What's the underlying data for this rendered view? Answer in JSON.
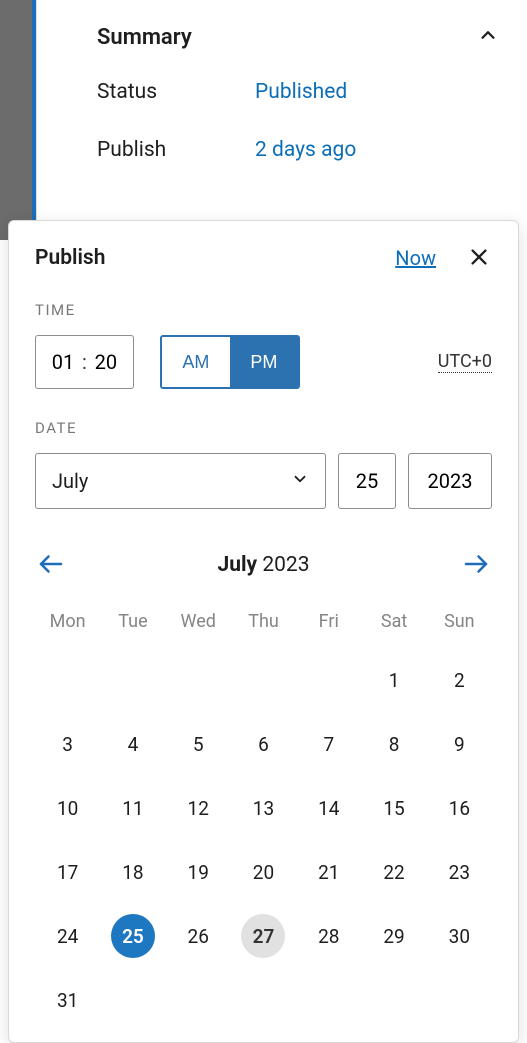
{
  "summary": {
    "title": "Summary",
    "status_label": "Status",
    "status_value": "Published",
    "publish_label": "Publish",
    "publish_value": "2 days ago"
  },
  "popover": {
    "title": "Publish",
    "now": "Now",
    "time_section": "TIME",
    "date_section": "DATE",
    "hours": "01",
    "minutes": "20",
    "am": "AM",
    "pm": "PM",
    "meridiem_selected": "pm",
    "timezone": "UTC+0",
    "month": "July",
    "day": "25",
    "year": "2023"
  },
  "calendar": {
    "month_label": "July",
    "year_label": "2023",
    "weekdays": [
      "Mon",
      "Tue",
      "Wed",
      "Thu",
      "Fri",
      "Sat",
      "Sun"
    ],
    "leading_blanks": 5,
    "days_in_month": 31,
    "selected_day": 25,
    "today": 27
  }
}
